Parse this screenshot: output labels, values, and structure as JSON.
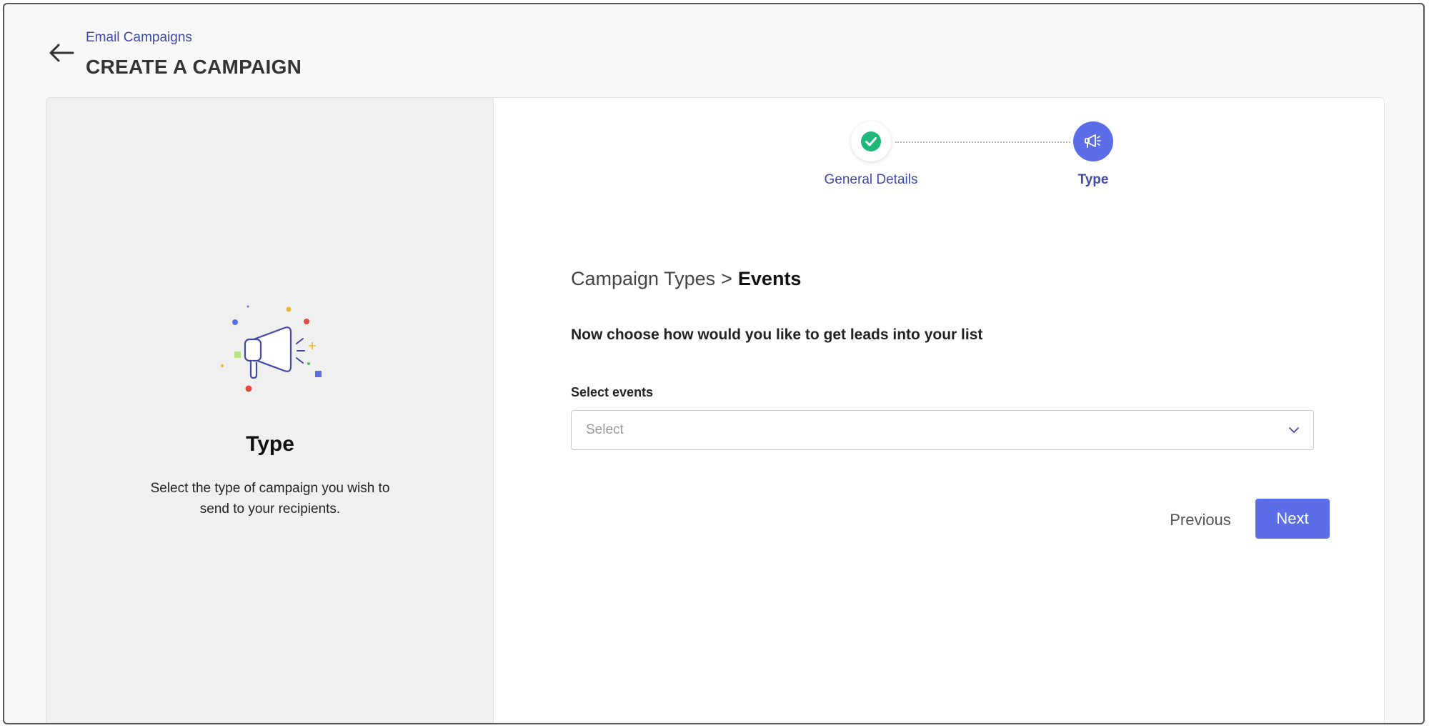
{
  "header": {
    "breadcrumb_link": "Email Campaigns",
    "title": "CREATE A CAMPAIGN"
  },
  "left_panel": {
    "title": "Type",
    "description": "Select the type of campaign you wish to send to your recipients.",
    "illustration_icon": "megaphone-icon"
  },
  "stepper": {
    "steps": [
      {
        "label": "General Details",
        "state": "completed",
        "icon": "check-icon"
      },
      {
        "label": "Type",
        "state": "active",
        "icon": "megaphone-icon"
      }
    ]
  },
  "main": {
    "crumb_parent": "Campaign Types",
    "crumb_separator": ">",
    "crumb_current": "Events",
    "prompt": "Now choose how would you like to get leads into your list",
    "field_label": "Select events",
    "select_placeholder": "Select"
  },
  "actions": {
    "previous_label": "Previous",
    "next_label": "Next"
  },
  "colors": {
    "accent": "#5b6ee8",
    "link": "#3f4aa8",
    "success": "#1db87a",
    "panel_bg": "#f0f0f0"
  }
}
